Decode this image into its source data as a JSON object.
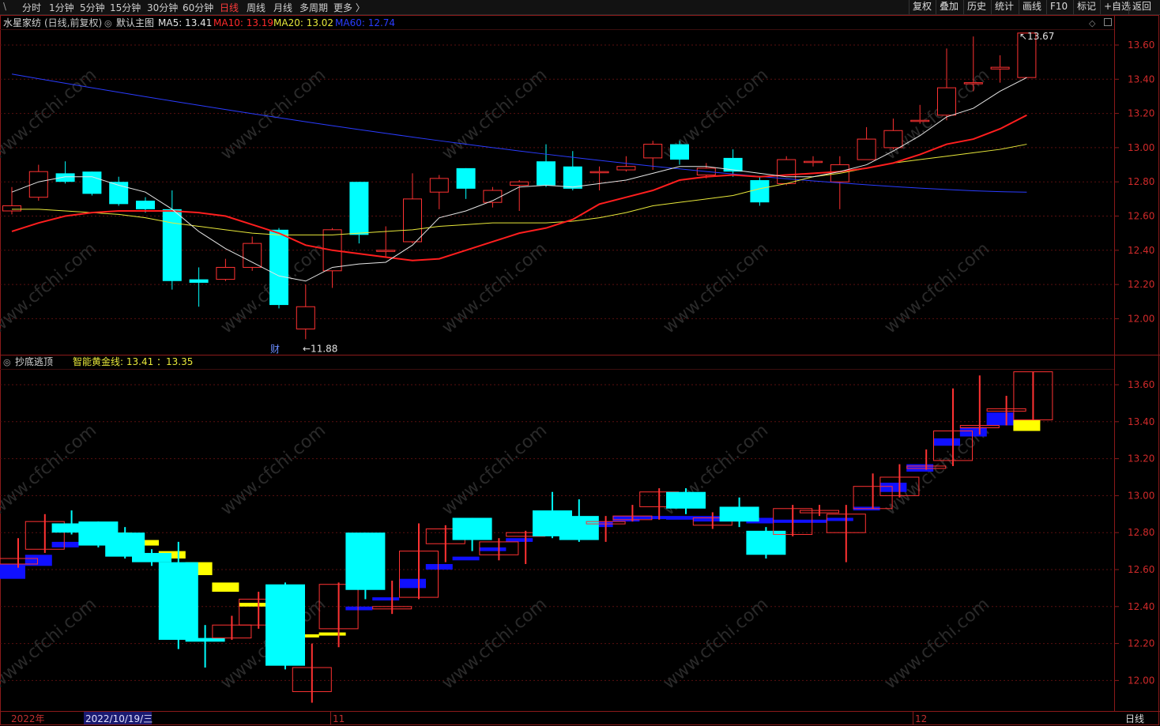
{
  "toolbar": {
    "back_glyph": "\\",
    "periods": [
      "分时",
      "1分钟",
      "5分钟",
      "15分钟",
      "30分钟",
      "60分钟",
      "日线",
      "周线",
      "月线",
      "多周期",
      "更多 〉"
    ],
    "active_period": "日线",
    "right_buttons": [
      "复权",
      "叠加",
      "历史",
      "统计",
      "画线",
      "F10",
      "标记",
      "+自选",
      "返回"
    ]
  },
  "main_panel": {
    "stock_name": "水星家纺",
    "adjust_mode": "(日线,前复权)",
    "template_label": "默认主图",
    "ma_labels": [
      {
        "text": "MA5: 13.41",
        "color": "#e6e6e6"
      },
      {
        "text": "MA10: 13.19",
        "color": "#ff2a2a"
      },
      {
        "text": "MA20: 13.02",
        "color": "#e8e83a"
      },
      {
        "text": "MA60: 12.74",
        "color": "#2a3cff"
      }
    ],
    "high_marker": "13.67",
    "low_marker": "11.88",
    "finance_marker": "财",
    "y_ticks": [
      "13.60",
      "13.40",
      "13.20",
      "13.00",
      "12.80",
      "12.60",
      "12.40",
      "12.20",
      "12.00"
    ]
  },
  "sub_panel": {
    "indicator_name": "抄底逃顶",
    "line_label": "智能黄金线: 13.41 ：13.35",
    "y_ticks": [
      "13.60",
      "13.40",
      "13.20",
      "13.00",
      "12.80",
      "12.60",
      "12.40",
      "12.20",
      "12.00"
    ]
  },
  "time_axis": {
    "year_label": "2022年",
    "cursor_date": "2022/10/19/三",
    "month_labels": [
      "11",
      "12"
    ],
    "period_label": "日线"
  },
  "watermark": "www.cfchi.com",
  "colors": {
    "up": "#ff3232",
    "down": "#00ffff",
    "ma5": "#e6e6e6",
    "ma10": "#ff1e1e",
    "ma20": "#e8e83a",
    "ma60": "#2a3cff",
    "gold": "#ffff00",
    "blue_box": "#1010ff",
    "frame": "#8b1a1a"
  },
  "chart_data": {
    "type": "candlestick",
    "y_range": [
      11.88,
      13.67
    ],
    "candles": [
      {
        "o": 12.63,
        "c": 12.66,
        "h": 12.77,
        "l": 12.61
      },
      {
        "o": 12.71,
        "c": 12.86,
        "h": 12.9,
        "l": 12.69
      },
      {
        "o": 12.85,
        "c": 12.8,
        "h": 12.92,
        "l": 12.79
      },
      {
        "o": 12.86,
        "c": 12.73,
        "h": 12.86,
        "l": 12.72
      },
      {
        "o": 12.8,
        "c": 12.67,
        "h": 12.83,
        "l": 12.66
      },
      {
        "o": 12.69,
        "c": 12.64,
        "h": 12.71,
        "l": 12.62
      },
      {
        "o": 12.64,
        "c": 12.22,
        "h": 12.75,
        "l": 12.17
      },
      {
        "o": 12.23,
        "c": 12.21,
        "h": 12.3,
        "l": 12.07
      },
      {
        "o": 12.23,
        "c": 12.3,
        "h": 12.35,
        "l": 12.22
      },
      {
        "o": 12.3,
        "c": 12.44,
        "h": 12.48,
        "l": 12.28
      },
      {
        "o": 12.52,
        "c": 12.08,
        "h": 12.53,
        "l": 12.06
      },
      {
        "o": 11.94,
        "c": 12.07,
        "h": 12.2,
        "l": 11.88
      },
      {
        "o": 12.28,
        "c": 12.52,
        "h": 12.53,
        "l": 12.18
      },
      {
        "o": 12.8,
        "c": 12.49,
        "h": 12.8,
        "l": 12.44
      },
      {
        "o": 12.4,
        "c": 12.4,
        "h": 12.54,
        "l": 12.36
      },
      {
        "o": 12.45,
        "c": 12.7,
        "h": 12.85,
        "l": 12.44
      },
      {
        "o": 12.74,
        "c": 12.82,
        "h": 12.84,
        "l": 12.64
      },
      {
        "o": 12.88,
        "c": 12.76,
        "h": 12.88,
        "l": 12.7
      },
      {
        "o": 12.68,
        "c": 12.75,
        "h": 12.77,
        "l": 12.65
      },
      {
        "o": 12.78,
        "c": 12.8,
        "h": 12.81,
        "l": 12.63
      },
      {
        "o": 12.92,
        "c": 12.78,
        "h": 13.02,
        "l": 12.77
      },
      {
        "o": 12.89,
        "c": 12.76,
        "h": 12.98,
        "l": 12.75
      },
      {
        "o": 12.86,
        "c": 12.86,
        "h": 12.89,
        "l": 12.75
      },
      {
        "o": 12.87,
        "c": 12.89,
        "h": 12.95,
        "l": 12.86
      },
      {
        "o": 12.94,
        "c": 13.02,
        "h": 13.04,
        "l": 12.87
      },
      {
        "o": 13.02,
        "c": 12.93,
        "h": 13.04,
        "l": 12.9
      },
      {
        "o": 12.84,
        "c": 12.88,
        "h": 12.91,
        "l": 12.82
      },
      {
        "o": 12.94,
        "c": 12.86,
        "h": 12.99,
        "l": 12.83
      },
      {
        "o": 12.81,
        "c": 12.68,
        "h": 12.83,
        "l": 12.66
      },
      {
        "o": 12.79,
        "c": 12.93,
        "h": 12.95,
        "l": 12.78
      },
      {
        "o": 12.92,
        "c": 12.92,
        "h": 12.95,
        "l": 12.89
      },
      {
        "o": 12.8,
        "c": 12.9,
        "h": 12.95,
        "l": 12.64
      },
      {
        "o": 12.93,
        "c": 13.05,
        "h": 13.12,
        "l": 12.93
      },
      {
        "o": 13.0,
        "c": 13.1,
        "h": 13.17,
        "l": 12.99
      },
      {
        "o": 13.16,
        "c": 13.16,
        "h": 13.25,
        "l": 13.14
      },
      {
        "o": 13.19,
        "c": 13.35,
        "h": 13.58,
        "l": 13.16
      },
      {
        "o": 13.38,
        "c": 13.38,
        "h": 13.65,
        "l": 13.33
      },
      {
        "o": 13.46,
        "c": 13.47,
        "h": 13.54,
        "l": 13.38
      },
      {
        "o": 13.41,
        "c": 13.67,
        "h": 13.67,
        "l": 13.41
      }
    ],
    "ma5": [
      12.74,
      12.8,
      12.83,
      12.83,
      12.78,
      12.74,
      12.64,
      12.51,
      12.41,
      12.33,
      12.25,
      12.22,
      12.3,
      12.32,
      12.33,
      12.43,
      12.59,
      12.63,
      12.69,
      12.77,
      12.78,
      12.77,
      12.79,
      12.81,
      12.85,
      12.89,
      12.89,
      12.87,
      12.85,
      12.83,
      12.83,
      12.86,
      12.9,
      12.98,
      13.07,
      13.18,
      13.23,
      13.33,
      13.41
    ],
    "ma10": [
      12.51,
      12.56,
      12.6,
      12.62,
      12.63,
      12.63,
      12.63,
      12.62,
      12.6,
      12.55,
      12.5,
      12.43,
      12.4,
      12.38,
      12.36,
      12.34,
      12.35,
      12.4,
      12.45,
      12.5,
      12.53,
      12.58,
      12.67,
      12.71,
      12.75,
      12.81,
      12.83,
      12.84,
      12.83,
      12.84,
      12.85,
      12.86,
      12.88,
      12.91,
      12.96,
      13.02,
      13.05,
      13.11,
      13.19
    ],
    "ma20": [
      12.64,
      12.64,
      12.63,
      12.62,
      12.61,
      12.59,
      12.56,
      12.54,
      12.52,
      12.5,
      12.49,
      12.49,
      12.49,
      12.5,
      12.51,
      12.52,
      12.54,
      12.55,
      12.56,
      12.56,
      12.56,
      12.57,
      12.59,
      12.62,
      12.66,
      12.68,
      12.7,
      12.72,
      12.76,
      12.79,
      12.83,
      12.85,
      12.88,
      12.91,
      12.93,
      12.95,
      12.97,
      12.99,
      13.02
    ],
    "ma60": {
      "start": 13.43,
      "end": 12.74
    },
    "sub_ma5": [
      12.55,
      12.62,
      12.72,
      12.81,
      12.8,
      12.76,
      12.7,
      12.64,
      12.53,
      12.42,
      12.38,
      12.25,
      12.26,
      12.38,
      12.44,
      12.5,
      12.6,
      12.65,
      12.7,
      12.75,
      12.8,
      12.81,
      12.83,
      12.86,
      12.88,
      12.87,
      12.86,
      12.86,
      12.85,
      12.86,
      12.86,
      12.87,
      12.92,
      13.02,
      13.13,
      13.27,
      13.32,
      13.38,
      13.41
    ],
    "sub_ma10": [
      12.63,
      12.68,
      12.75,
      12.79,
      12.77,
      12.73,
      12.66,
      12.57,
      12.48,
      12.4,
      12.38,
      12.25,
      12.25,
      12.4,
      12.45,
      12.55,
      12.63,
      12.67,
      12.72,
      12.77,
      12.81,
      12.84,
      12.86,
      12.89,
      12.89,
      12.89,
      12.89,
      12.88,
      12.88,
      12.87,
      12.87,
      12.88,
      12.94,
      13.07,
      13.17,
      13.31,
      13.37,
      13.45,
      13.35
    ]
  }
}
